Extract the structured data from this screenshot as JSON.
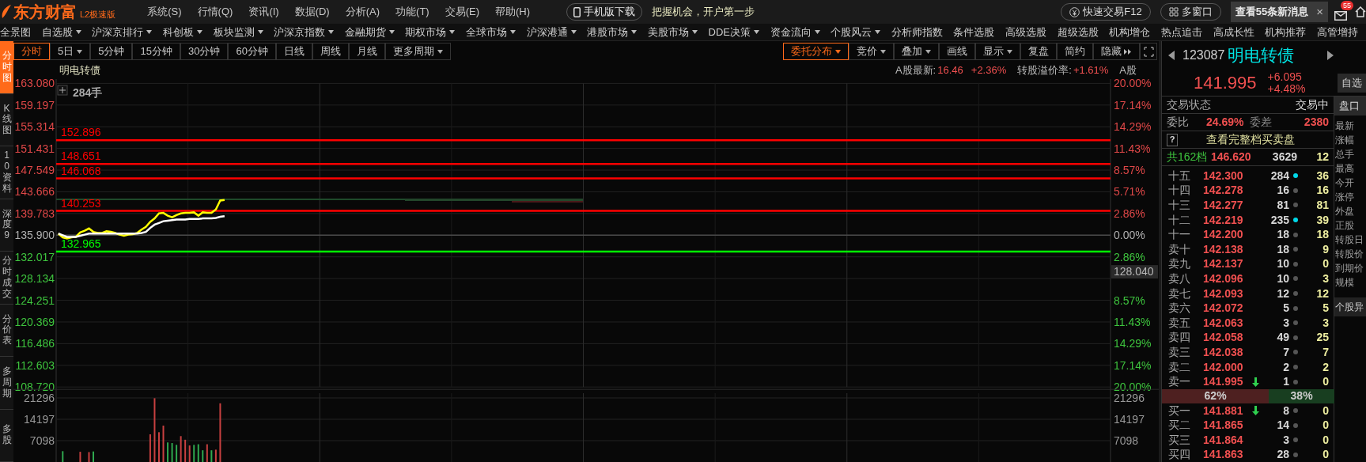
{
  "app": {
    "logo": "东方财富",
    "edition": "L2极速版",
    "menu": [
      "系统(S)",
      "行情(Q)",
      "资讯(I)",
      "数据(D)",
      "分析(A)",
      "功能(T)",
      "交易(E)",
      "帮助(H)"
    ],
    "mobile_button": "手机版下载",
    "slogan": "把握机会，开户第一步",
    "quick_trade": "快速交易F12",
    "multi_window": "多窗口",
    "news": "查看55条新消息",
    "news_close": "×",
    "mail_badge": "55"
  },
  "nav": [
    {
      "label": "全景图",
      "dropdown": false
    },
    {
      "label": "自选股",
      "dropdown": true
    },
    {
      "label": "沪深京排行",
      "dropdown": true
    },
    {
      "label": "科创板",
      "dropdown": true
    },
    {
      "label": "板块监测",
      "dropdown": true
    },
    {
      "label": "沪深京指数",
      "dropdown": true
    },
    {
      "label": "金融期货",
      "dropdown": true
    },
    {
      "label": "期权市场",
      "dropdown": true
    },
    {
      "label": "全球市场",
      "dropdown": true
    },
    {
      "label": "沪深港通",
      "dropdown": true
    },
    {
      "label": "港股市场",
      "dropdown": true
    },
    {
      "label": "美股市场",
      "dropdown": true
    },
    {
      "label": "DDE决策",
      "dropdown": true
    },
    {
      "label": "资金流向",
      "dropdown": true
    },
    {
      "label": "个股风云",
      "dropdown": true
    },
    {
      "label": "分析师指数",
      "dropdown": false
    },
    {
      "label": "条件选股",
      "dropdown": false
    },
    {
      "label": "高级选股",
      "dropdown": false
    },
    {
      "label": "超级选股",
      "dropdown": false
    },
    {
      "label": "机构增仓",
      "dropdown": false
    },
    {
      "label": "热点追击",
      "dropdown": false
    },
    {
      "label": "高成长性",
      "dropdown": false
    },
    {
      "label": "机构推荐",
      "dropdown": false
    },
    {
      "label": "高管增持",
      "dropdown": false
    }
  ],
  "side_tabs": [
    {
      "label": "分时图",
      "selected": true
    },
    {
      "label": "K线图",
      "selected": false
    },
    {
      "label": "10资料",
      "selected": false
    },
    {
      "label": "深度9",
      "selected": false
    },
    {
      "label": "分时成交",
      "selected": false
    },
    {
      "label": "分价表",
      "selected": false
    },
    {
      "label": "多周期",
      "selected": false
    },
    {
      "label": "多股",
      "selected": false
    }
  ],
  "periods": [
    {
      "label": "分时",
      "selected": true,
      "kind": "plain"
    },
    {
      "label": "5日",
      "selected": false,
      "kind": "menu"
    },
    {
      "label": "5分钟",
      "selected": false,
      "kind": "plain"
    },
    {
      "label": "15分钟",
      "selected": false,
      "kind": "plain"
    },
    {
      "label": "30分钟",
      "selected": false,
      "kind": "plain"
    },
    {
      "label": "60分钟",
      "selected": false,
      "kind": "plain"
    },
    {
      "label": "日线",
      "selected": false,
      "kind": "plain"
    },
    {
      "label": "周线",
      "selected": false,
      "kind": "plain"
    },
    {
      "label": "月线",
      "selected": false,
      "kind": "plain"
    },
    {
      "label": "更多周期",
      "selected": false,
      "kind": "menu"
    }
  ],
  "tools": [
    {
      "label": "委托分布",
      "selected": true,
      "kind": "menu"
    },
    {
      "label": "竞价",
      "selected": false,
      "kind": "menu"
    },
    {
      "label": "叠加",
      "selected": false,
      "kind": "menu"
    },
    {
      "label": "画线",
      "selected": false,
      "kind": "plain"
    },
    {
      "label": "显示",
      "selected": false,
      "kind": "menu"
    },
    {
      "label": "复盘",
      "selected": false,
      "kind": "plain"
    },
    {
      "label": "简约",
      "selected": false,
      "kind": "plain"
    },
    {
      "label": "隐藏",
      "selected": false,
      "kind": "collapse"
    }
  ],
  "chart": {
    "title": "明电转债",
    "a_share_label": "A股最新:",
    "a_share_price": "16.46",
    "a_share_change": "+2.36%",
    "premium_label": "转股溢价率:",
    "premium": "+1.61%",
    "a_share_tag": "A股",
    "cursor_volume": "284手",
    "price_chart": {
      "chart_data": {
        "type": "line",
        "grid": true,
        "ylim": [
          108.72,
          163.08
        ],
        "categories": [
          null,
          null,
          null,
          null,
          null,
          null,
          null,
          null,
          null,
          null,
          null,
          null,
          null,
          null,
          null,
          null,
          null,
          null,
          null,
          null,
          null,
          null,
          null,
          null,
          null,
          null,
          null,
          null,
          null,
          null,
          null,
          null,
          null,
          null,
          null,
          null,
          null,
          null,
          null,
          null,
          null,
          null,
          null,
          null,
          null,
          null,
          null,
          null,
          null,
          null,
          null,
          null,
          null,
          null,
          null,
          null,
          null,
          null,
          null,
          null,
          null,
          null,
          null,
          null,
          null,
          null,
          null,
          null,
          null,
          null,
          null,
          null,
          null,
          null,
          null,
          null,
          null,
          null,
          null,
          null,
          null,
          null,
          null,
          null,
          null,
          null,
          null,
          null,
          null,
          null,
          null,
          null,
          null,
          null,
          null,
          null,
          null,
          null,
          null,
          null,
          null,
          null,
          null,
          null,
          null,
          null,
          null,
          null,
          null,
          null,
          null,
          null,
          null,
          null,
          null,
          null,
          null,
          null,
          null,
          null,
          null,
          null,
          null,
          null,
          null,
          null,
          null,
          null,
          null,
          null,
          null,
          null,
          null,
          null,
          null,
          null,
          null,
          null,
          null,
          null,
          null,
          null,
          null,
          null,
          null,
          null,
          null,
          null,
          null,
          null,
          null,
          null,
          null,
          null,
          null,
          null,
          null,
          null,
          null,
          null,
          null,
          null,
          null,
          null,
          null,
          null,
          null,
          null,
          null,
          null,
          null,
          null,
          null,
          null,
          null,
          null,
          null,
          null,
          null,
          null,
          null,
          null,
          null,
          null,
          null,
          null,
          null,
          null,
          null,
          null,
          null,
          null,
          null,
          null,
          null,
          null,
          null,
          null,
          null,
          null,
          null,
          null,
          null,
          null,
          null,
          null,
          null,
          null,
          null,
          null,
          null,
          null,
          null,
          null,
          null,
          null,
          null,
          null,
          null,
          null,
          null,
          null,
          null,
          null,
          null,
          null,
          null,
          null,
          null,
          null,
          null,
          null,
          null,
          null,
          null,
          null,
          null,
          null,
          null,
          null,
          null
        ],
        "yticks": [
          {
            "value": 163.08,
            "label": "163.080"
          },
          {
            "value": 159.197,
            "label": "159.197"
          },
          {
            "value": 155.314,
            "label": "155.314"
          },
          {
            "value": 151.431,
            "label": "151.431"
          },
          {
            "value": 147.549,
            "label": "147.549"
          },
          {
            "value": 143.666,
            "label": "143.666"
          },
          {
            "value": 139.783,
            "label": "139.783"
          },
          {
            "value": 135.9,
            "label": "135.900"
          },
          {
            "value": 132.017,
            "label": "132.017"
          },
          {
            "value": 128.134,
            "label": "128.134"
          },
          {
            "value": 124.251,
            "label": "124.251"
          },
          {
            "value": 120.369,
            "label": "120.369"
          },
          {
            "value": 116.486,
            "label": "116.486"
          },
          {
            "value": 112.603,
            "label": "112.603"
          },
          {
            "value": 108.72,
            "label": "108.720"
          }
        ],
        "series": [
          {
            "color": "#ffff00",
            "values": [
              136.2,
              135.5,
              135.3,
              135.5,
              135.6,
              136.4,
              136.7,
              137.1,
              136.5,
              136.3,
              136.3,
              136.6,
              136.5,
              136.3,
              136.0,
              135.8,
              136.0,
              136.1,
              136.3,
              136.9,
              137.4,
              138.3,
              138.9,
              139.8,
              139.9,
              139.4,
              139.1,
              139.5,
              139.8,
              139.9,
              139.9,
              140.0,
              139.4,
              140.0,
              139.9,
              139.9,
              140.5,
              142.1,
              142.2,
              null,
              null,
              null,
              null,
              null,
              null,
              null,
              null,
              null,
              null,
              null,
              null,
              null,
              null,
              null,
              null,
              null,
              null,
              null,
              null,
              null,
              null,
              null,
              null,
              null,
              null,
              null,
              null,
              null,
              null,
              null,
              null,
              null,
              null,
              null,
              null,
              null,
              null,
              null,
              null,
              null,
              null,
              null,
              null,
              null,
              null,
              null,
              null,
              null,
              null,
              null,
              null,
              null,
              null,
              null,
              null,
              null,
              null,
              null,
              null,
              null,
              null,
              null,
              null,
              null,
              null,
              null,
              null,
              null,
              null,
              null,
              null,
              null,
              null,
              null,
              null,
              null,
              null,
              null,
              null,
              null,
              null,
              null,
              null,
              null,
              null,
              null,
              null,
              null,
              null,
              null,
              null,
              null,
              null,
              null,
              null,
              null,
              null,
              null,
              null,
              null,
              null,
              null,
              null,
              null,
              null,
              null,
              null,
              null,
              null,
              null,
              null,
              null,
              null,
              null,
              null,
              null,
              null,
              null,
              null,
              null,
              null,
              null,
              null,
              null,
              null,
              null,
              null,
              null,
              null,
              null,
              null,
              null,
              null,
              null,
              null,
              null,
              null,
              null,
              null,
              null,
              null,
              null,
              null,
              null,
              null,
              null,
              null,
              null,
              null,
              null,
              null,
              null,
              null,
              null,
              null,
              null,
              null,
              null,
              null,
              null,
              null,
              null,
              null,
              null,
              null,
              null,
              null,
              null,
              null,
              null,
              null,
              null,
              null,
              null,
              null,
              null,
              null,
              null,
              null,
              null,
              null,
              null,
              null,
              null,
              null,
              null,
              null,
              null,
              null,
              null,
              null,
              null,
              null,
              null,
              null,
              null,
              null,
              null,
              null,
              null,
              null
            ]
          },
          {
            "color": "#ffffff",
            "values": [
              136.2,
              135.9,
              135.6,
              135.6,
              135.6,
              135.8,
              136.0,
              136.2,
              136.2,
              136.2,
              136.2,
              136.2,
              136.2,
              136.2,
              136.2,
              136.2,
              136.2,
              136.2,
              136.2,
              136.3,
              136.5,
              137.2,
              137.8,
              138.1,
              138.4,
              138.5,
              138.6,
              138.7,
              138.7,
              138.7,
              138.8,
              138.8,
              138.8,
              138.9,
              138.9,
              138.9,
              139.0,
              139.2,
              139.3,
              null,
              null,
              null,
              null,
              null,
              null,
              null,
              null,
              null,
              null,
              null,
              null,
              null,
              null,
              null,
              null,
              null,
              null,
              null,
              null,
              null,
              null,
              null,
              null,
              null,
              null,
              null,
              null,
              null,
              null,
              null,
              null,
              null,
              null,
              null,
              null,
              null,
              null,
              null,
              null,
              null,
              null,
              null,
              null,
              null,
              null,
              null,
              null,
              null,
              null,
              null,
              null,
              null,
              null,
              null,
              null,
              null,
              null,
              null,
              null,
              null,
              null,
              null,
              null,
              null,
              null,
              null,
              null,
              null,
              null,
              null,
              null,
              null,
              null,
              null,
              null,
              null,
              null,
              null,
              null,
              null,
              null,
              null,
              null,
              null,
              null,
              null,
              null,
              null,
              null,
              null,
              null,
              null,
              null,
              null,
              null,
              null,
              null,
              null,
              null,
              null,
              null,
              null,
              null,
              null,
              null,
              null,
              null,
              null,
              null,
              null,
              null,
              null,
              null,
              null,
              null,
              null,
              null,
              null,
              null,
              null,
              null,
              null,
              null,
              null,
              null,
              null,
              null,
              null,
              null,
              null,
              null,
              null,
              null,
              null,
              null,
              null,
              null,
              null,
              null,
              null,
              null,
              null,
              null,
              null,
              null,
              null,
              null,
              null,
              null,
              null,
              null,
              null,
              null,
              null,
              null,
              null,
              null,
              null,
              null,
              null,
              null,
              null,
              null,
              null,
              null,
              null,
              null,
              null,
              null,
              null,
              null,
              null,
              null,
              null,
              null,
              null,
              null,
              null,
              null,
              null,
              null,
              null,
              null,
              null,
              null,
              null,
              null,
              null,
              null,
              null,
              null,
              null,
              null,
              null,
              null,
              null,
              null,
              null,
              null,
              null,
              null
            ]
          }
        ],
        "ref_lines": [
          {
            "axis": "y",
            "value": 152.896,
            "label": "152.896",
            "color": "#ff0000"
          },
          {
            "axis": "y",
            "value": 148.651,
            "label": "148.651",
            "color": "#ff0000"
          },
          {
            "axis": "y",
            "value": 146.068,
            "label": "146.068",
            "color": "#ff0000"
          },
          {
            "axis": "y",
            "value": 140.253,
            "label": "140.253",
            "color": "#ff0000"
          },
          {
            "axis": "y",
            "value": 135.9,
            "color": "#4a4a4a"
          },
          {
            "axis": "y",
            "value": 132.965,
            "label": "132.965",
            "color": "#00ff00"
          }
        ]
      },
      "right_ticks": [
        {
          "label": "20.00%",
          "kind": "tick",
          "color": "#e04848"
        },
        {
          "label": "17.14%",
          "kind": "tick",
          "color": "#e04848"
        },
        {
          "label": "14.29%",
          "kind": "tick",
          "color": "#e04848"
        },
        {
          "label": "11.43%",
          "kind": "tick",
          "color": "#e04848"
        },
        {
          "label": "8.57%",
          "kind": "tick",
          "color": "#e04848"
        },
        {
          "label": "5.71%",
          "kind": "tick",
          "color": "#e04848"
        },
        {
          "label": "2.86%",
          "kind": "tick",
          "color": "#e04848"
        },
        {
          "label": "0.00%",
          "kind": "tick",
          "color": "#b0b0b0"
        },
        {
          "label": "2.86%",
          "kind": "tick",
          "color": "#3ec43e"
        },
        {
          "label": "128.040",
          "kind": "cursor"
        },
        {
          "label": "8.57%",
          "kind": "tick",
          "color": "#3ec43e"
        },
        {
          "label": "11.43%",
          "kind": "tick",
          "color": "#3ec43e"
        },
        {
          "label": "14.29%",
          "kind": "tick",
          "color": "#3ec43e"
        },
        {
          "label": "17.14%",
          "kind": "tick",
          "color": "#3ec43e"
        },
        {
          "label": "20.00%",
          "kind": "tick",
          "color": "#3ec43e"
        }
      ]
    },
    "volume_chart": {
      "chart_data": {
        "type": "bar",
        "grid": true,
        "ylim": [
          0,
          21296
        ],
        "yticks": [
          21296,
          14197,
          7098
        ],
        "categories": [
          null,
          null,
          null,
          null,
          null,
          null,
          null,
          null,
          null,
          null,
          null,
          null,
          null,
          null,
          null,
          null,
          null,
          null,
          null,
          null,
          null,
          null,
          null,
          null,
          null,
          null,
          null,
          null,
          null,
          null,
          null,
          null,
          null,
          null,
          null,
          null,
          null,
          null,
          null,
          null,
          null,
          null,
          null,
          null,
          null,
          null,
          null,
          null,
          null,
          null,
          null,
          null,
          null,
          null,
          null,
          null,
          null,
          null,
          null,
          null,
          null,
          null,
          null,
          null,
          null,
          null,
          null,
          null,
          null,
          null,
          null,
          null,
          null,
          null,
          null,
          null,
          null,
          null,
          null,
          null,
          null,
          null,
          null,
          null,
          null,
          null,
          null,
          null,
          null,
          null,
          null,
          null,
          null,
          null,
          null,
          null,
          null,
          null,
          null,
          null,
          null,
          null,
          null,
          null,
          null,
          null,
          null,
          null,
          null,
          null,
          null,
          null,
          null,
          null,
          null,
          null,
          null,
          null,
          null,
          null,
          null,
          null,
          null,
          null,
          null,
          null,
          null,
          null,
          null,
          null,
          null,
          null,
          null,
          null,
          null,
          null,
          null,
          null,
          null,
          null,
          null,
          null,
          null,
          null,
          null,
          null,
          null,
          null,
          null,
          null,
          null,
          null,
          null,
          null,
          null,
          null,
          null,
          null,
          null,
          null,
          null,
          null,
          null,
          null,
          null,
          null,
          null,
          null,
          null,
          null,
          null,
          null,
          null,
          null,
          null,
          null,
          null,
          null,
          null,
          null,
          null,
          null,
          null,
          null,
          null,
          null,
          null,
          null,
          null,
          null,
          null,
          null,
          null,
          null,
          null,
          null,
          null,
          null,
          null,
          null,
          null,
          null,
          null,
          null,
          null,
          null,
          null,
          null,
          null,
          null,
          null,
          null,
          null,
          null,
          null,
          null,
          null,
          null,
          null,
          null,
          null,
          null,
          null,
          null,
          null,
          null,
          null,
          null,
          null,
          null,
          null,
          null,
          null,
          null,
          null,
          null,
          null,
          null,
          null,
          null,
          null
        ],
        "series": [
          {
            "color": "#c84040",
            "values": [
              null,
              null,
              null,
              null,
              null,
              3400,
              null,
              3300,
              null,
              null,
              null,
              null,
              null,
              null,
              null,
              null,
              null,
              null,
              null,
              null,
              null,
              9200,
              21200,
              9900,
              12100,
              null,
              null,
              null,
              8600,
              7400,
              5500,
              null,
              null,
              null,
              5900,
              null,
              4100,
              19500,
              null,
              null,
              null,
              null,
              null,
              null,
              null,
              null,
              null,
              null,
              null,
              null,
              null,
              null,
              null,
              null,
              null,
              null,
              null,
              null,
              null,
              null,
              null,
              null,
              null,
              null,
              null,
              null,
              null,
              null,
              null,
              null,
              null,
              null,
              null,
              null,
              null,
              null,
              null,
              null,
              null,
              null,
              null,
              null,
              null,
              null,
              null,
              null,
              null,
              null,
              null,
              null,
              null,
              null,
              null,
              null,
              null,
              null,
              null,
              null,
              null,
              null,
              null,
              null,
              null,
              null,
              null,
              null,
              null,
              null,
              null,
              null,
              null,
              null,
              null,
              null,
              null,
              null,
              null,
              null,
              null,
              null,
              null,
              null,
              null,
              null,
              null,
              null,
              null,
              null,
              null,
              null,
              null,
              null,
              null,
              null,
              null,
              null,
              null,
              null,
              null,
              null,
              null,
              null,
              null,
              null,
              null,
              null,
              null,
              null,
              null,
              null,
              null,
              null,
              null,
              null,
              null,
              null,
              null,
              null,
              null,
              null,
              null,
              null,
              null,
              null,
              null,
              null,
              null,
              null,
              null,
              null,
              null,
              null,
              null,
              null,
              null,
              null,
              null,
              null,
              null,
              null,
              null,
              null,
              null,
              null,
              null,
              null,
              null,
              null,
              null,
              null,
              null,
              null,
              null,
              null,
              null,
              null,
              null,
              null,
              null,
              null,
              null,
              null,
              null,
              null,
              null,
              null,
              null,
              null,
              null,
              null,
              null,
              null,
              null,
              null,
              null,
              null,
              null,
              null,
              null,
              null,
              null,
              null,
              null,
              null,
              null,
              null,
              null,
              null,
              null,
              null,
              null,
              null,
              null,
              null,
              null,
              null,
              null,
              null,
              null,
              null,
              null
            ]
          },
          {
            "color": "#2fa84f",
            "values": [
              null,
              3600,
              null,
              null,
              null,
              null,
              null,
              null,
              3500,
              null,
              null,
              null,
              null,
              null,
              null,
              null,
              null,
              null,
              null,
              null,
              null,
              null,
              null,
              null,
              null,
              6500,
              6300,
              5700,
              null,
              null,
              null,
              5700,
              5900,
              3900,
              null,
              3900,
              null,
              null,
              null,
              null,
              null,
              null,
              null,
              null,
              null,
              null,
              null,
              null,
              null,
              null,
              null,
              null,
              null,
              null,
              null,
              null,
              null,
              null,
              null,
              null,
              null,
              null,
              null,
              null,
              null,
              null,
              null,
              null,
              null,
              null,
              null,
              null,
              null,
              null,
              null,
              null,
              null,
              null,
              null,
              null,
              null,
              null,
              null,
              null,
              null,
              null,
              null,
              null,
              null,
              null,
              null,
              null,
              null,
              null,
              null,
              null,
              null,
              null,
              null,
              null,
              null,
              null,
              null,
              null,
              null,
              null,
              null,
              null,
              null,
              null,
              null,
              null,
              null,
              null,
              null,
              null,
              null,
              null,
              null,
              null,
              null,
              null,
              null,
              null,
              null,
              null,
              null,
              null,
              null,
              null,
              null,
              null,
              null,
              null,
              null,
              null,
              null,
              null,
              null,
              null,
              null,
              null,
              null,
              null,
              null,
              null,
              null,
              null,
              null,
              null,
              null,
              null,
              null,
              null,
              null,
              null,
              null,
              null,
              null,
              null,
              null,
              null,
              null,
              null,
              null,
              null,
              null,
              null,
              null,
              null,
              null,
              null,
              null,
              null,
              null,
              null,
              null,
              null,
              null,
              null,
              null,
              null,
              null,
              null,
              null,
              null,
              null,
              null,
              null,
              null,
              null,
              null,
              null,
              null,
              null,
              null,
              null,
              null,
              null,
              null,
              null,
              null,
              null,
              null,
              null,
              null,
              null,
              null,
              null,
              null,
              null,
              null,
              null,
              null,
              null,
              null,
              null,
              null,
              null,
              null,
              null,
              null,
              null,
              null,
              null,
              null,
              null,
              null,
              null,
              null,
              null,
              null,
              null,
              null,
              null,
              null,
              null,
              null,
              null,
              null,
              null
            ]
          }
        ]
      },
      "right_ticks": [
        "21296",
        "14197",
        "7098"
      ]
    }
  },
  "quote": {
    "code": "123087",
    "name": "明电转债",
    "price": "141.995",
    "change": "+6.095",
    "change_pct": "+4.48%",
    "watch_button": "自选"
  },
  "book": {
    "status_label": "交易状态",
    "status": "交易中",
    "ratio_label": "委比",
    "ratio": "24.69%",
    "diff_label": "委差",
    "diff": "2380",
    "help": "?",
    "full_link": "查看完整档买卖盘",
    "total_label": "共162档",
    "total_price": "146.620",
    "total_volume": "3629",
    "total_count": "12",
    "asks": [
      {
        "label": "十五",
        "price": "142.300",
        "volume": "284",
        "count": "36",
        "color": "#00d8e8",
        "falling": false
      },
      {
        "label": "十四",
        "price": "142.278",
        "volume": "16",
        "count": "16",
        "color": "#555555",
        "falling": false
      },
      {
        "label": "十三",
        "price": "142.277",
        "volume": "81",
        "count": "81",
        "color": "#555555",
        "falling": false
      },
      {
        "label": "十二",
        "price": "142.219",
        "volume": "235",
        "count": "39",
        "color": "#00d8e8",
        "falling": false
      },
      {
        "label": "十一",
        "price": "142.200",
        "volume": "18",
        "count": "18",
        "color": "#555555",
        "falling": false
      },
      {
        "label": "卖十",
        "price": "142.138",
        "volume": "18",
        "count": "9",
        "color": "#555555",
        "falling": false
      },
      {
        "label": "卖九",
        "price": "142.137",
        "volume": "10",
        "count": "0",
        "color": "#555555",
        "falling": false
      },
      {
        "label": "卖八",
        "price": "142.096",
        "volume": "10",
        "count": "3",
        "color": "#555555",
        "falling": false
      },
      {
        "label": "卖七",
        "price": "142.093",
        "volume": "12",
        "count": "12",
        "color": "#555555",
        "falling": false
      },
      {
        "label": "卖六",
        "price": "142.072",
        "volume": "5",
        "count": "5",
        "color": "#555555",
        "falling": false
      },
      {
        "label": "卖五",
        "price": "142.063",
        "volume": "3",
        "count": "3",
        "color": "#555555",
        "falling": false
      },
      {
        "label": "卖四",
        "price": "142.058",
        "volume": "49",
        "count": "25",
        "color": "#555555",
        "falling": false
      },
      {
        "label": "卖三",
        "price": "142.038",
        "volume": "7",
        "count": "7",
        "color": "#555555",
        "falling": false
      },
      {
        "label": "卖二",
        "price": "142.000",
        "volume": "2",
        "count": "2",
        "color": "#555555",
        "falling": false
      },
      {
        "label": "卖一",
        "price": "141.995",
        "volume": "1",
        "count": "0",
        "color": "#555555",
        "falling": true
      }
    ],
    "split": {
      "ask_share": "62%",
      "bid_share": "38%",
      "level": 0.62
    },
    "bids": [
      {
        "label": "买一",
        "price": "141.881",
        "volume": "8",
        "count": "0",
        "color": "#555555",
        "falling": true
      },
      {
        "label": "买二",
        "price": "141.865",
        "volume": "14",
        "count": "0",
        "color": "#555555",
        "falling": false
      },
      {
        "label": "买三",
        "price": "141.864",
        "volume": "3",
        "count": "0",
        "color": "#555555",
        "falling": false
      },
      {
        "label": "买四",
        "price": "141.863",
        "volume": "28",
        "count": "0",
        "color": "#555555",
        "falling": false
      }
    ]
  },
  "side": {
    "tab": "盘口",
    "fields": [
      "最新",
      "涨幅",
      "总手",
      "最高",
      "今开",
      "涨停",
      "外盘",
      "正股",
      "转股日",
      "转股价",
      "到期价",
      "规模"
    ],
    "bottom_tab": "个股异"
  }
}
